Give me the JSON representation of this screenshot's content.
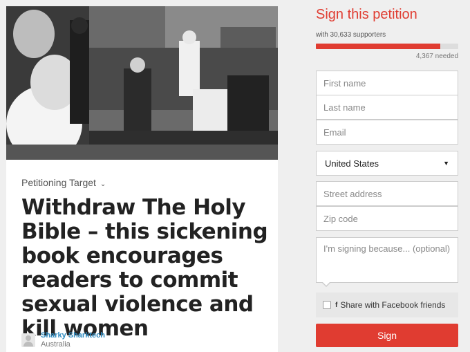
{
  "petition": {
    "target_label": "Petitioning Target",
    "title": "Withdraw The Holy Bible – this sickening book encourages readers to commit sexual violence and kill women",
    "author_name": "Sharky Sharktech",
    "author_location": "Australia"
  },
  "sign_form": {
    "heading": "Sign this petition",
    "supporters_text": "with 30,633 supporters",
    "needed_text": "4,367 needed",
    "progress_fraction": 0.875,
    "first_name_placeholder": "First name",
    "last_name_placeholder": "Last name",
    "email_placeholder": "Email",
    "country": "United States",
    "street_placeholder": "Street address",
    "zip_placeholder": "Zip code",
    "reason_placeholder": "I'm signing because... (optional)",
    "facebook_share_label": "Share with Facebook friends",
    "sign_button": "Sign"
  },
  "colors": {
    "accent": "#e03c31",
    "link": "#2f8bc0",
    "background": "#efefef"
  },
  "icons": {
    "target_dropdown": "chevron-down-icon",
    "country_select": "caret-down-icon",
    "facebook": "facebook-icon",
    "avatar": "user-avatar-icon"
  }
}
